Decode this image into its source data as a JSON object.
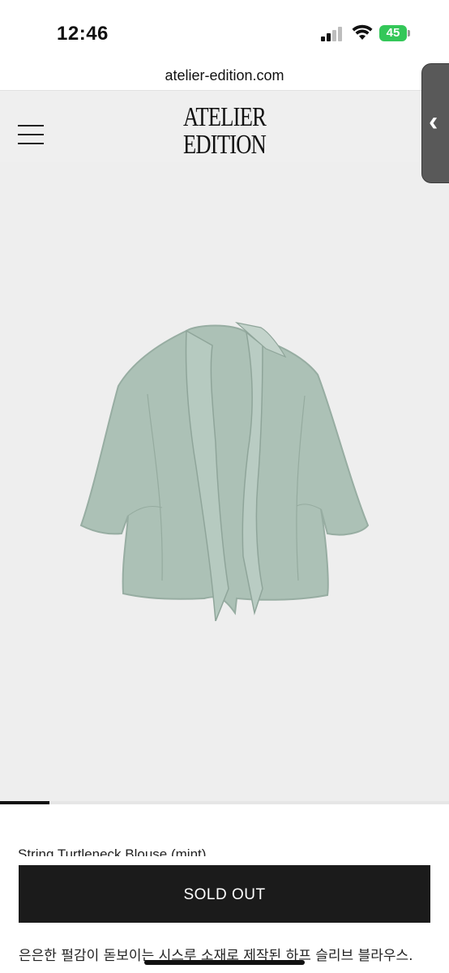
{
  "status_bar": {
    "time": "12:46",
    "battery": "45"
  },
  "browser": {
    "url": "atelier-edition.com"
  },
  "site": {
    "logo_line1": "ATELIER",
    "logo_line2": "EDITION"
  },
  "product": {
    "name": "String Turtleneck Blouse (mint)",
    "button_label": "SOLD OUT",
    "description": "은은한 펄감이 돋보이는 시스루 소재로 제작된 하프 슬리브 블라우스.",
    "image_color": "#a9bfb4"
  },
  "gallery": {
    "progress": 0.11
  },
  "colors": {
    "accent": "#1b1b1b",
    "battery": "#34c759",
    "hero_bg": "#eeeeee"
  }
}
